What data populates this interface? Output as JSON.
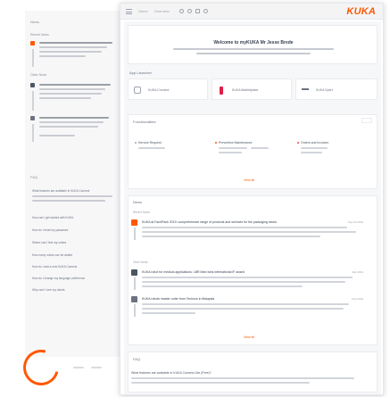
{
  "window": {
    "brand": "KUKA",
    "top_nav": [
      "Home",
      "Overview"
    ]
  },
  "welcome": {
    "title": "Welcome to myKUKA Mr Jesse Brede"
  },
  "app_launcher": {
    "label": "App Launcher",
    "apps": [
      {
        "label": "KUKA Connect",
        "icon": "robot-icon",
        "color": "#9ca3af"
      },
      {
        "label": "KUKA Marketplace",
        "icon": "marketplace-icon",
        "color": "#e11d48"
      },
      {
        "label": "KUKA Xpert",
        "icon": "xpert-icon",
        "color": "#6b7280"
      }
    ]
  },
  "functions": {
    "label": "Functionalities",
    "columns": [
      {
        "title": "Service Request",
        "color": "#9ca3af"
      },
      {
        "title": "Preventive Maintenance",
        "color": "#ff5800"
      },
      {
        "title": "Orders and invoices",
        "color": "#ef4444"
      }
    ],
    "link": "View all"
  },
  "news": {
    "label": "News",
    "recent_label": "Recent News",
    "older_label": "Older News",
    "items": [
      {
        "title": "KUKA at FachPack 2019: comprehensive range of products and services for the packaging sector",
        "date": "Sep 03 2019",
        "color": "#ff5800"
      },
      {
        "title": "KUKA robot for medical applications: LBR Med wins international iF award",
        "date": "Mar 2019",
        "color": "#4b5563"
      },
      {
        "title": "KUKA robots master order from Technos in Malaysia",
        "date": "Feb 2019",
        "color": "#6b7280"
      }
    ],
    "link": "View all"
  },
  "faq": {
    "label": "FAQ",
    "items": [
      "What features are available in KUKA Connect Lite (Free)?"
    ]
  },
  "background": {
    "news_heading": "News",
    "recent_label": "Recent News",
    "older_label": "Older News",
    "faq_heading": "FAQ",
    "faq_items": [
      "What features are available in KUKA Connect",
      "How can I get started with KUKA",
      "How do I reset my password",
      "Where can I find my orders",
      "How many robots can be added",
      "How do I add a new KUKA Connect",
      "How do I change my language preference",
      "Why can't I see my robots"
    ]
  }
}
